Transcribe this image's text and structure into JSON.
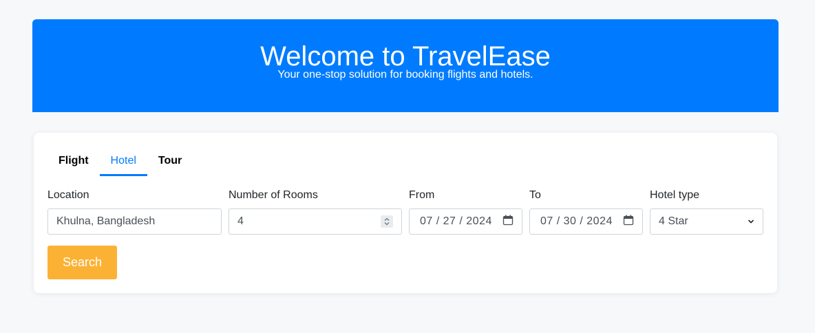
{
  "header": {
    "title": "Welcome to TravelEase",
    "subtitle": "Your one-stop solution for booking flights and hotels.",
    "bg_color": "#007bff"
  },
  "tabs": [
    {
      "label": "Flight",
      "active": false
    },
    {
      "label": "Hotel",
      "active": true
    },
    {
      "label": "Tour",
      "active": false
    }
  ],
  "form": {
    "location": {
      "label": "Location",
      "value": "Khulna, Bangladesh"
    },
    "rooms": {
      "label": "Number of Rooms",
      "value": "4"
    },
    "from": {
      "label": "From",
      "value": "07 / 27 / 2024"
    },
    "to": {
      "label": "To",
      "value": "07 / 30 / 2024"
    },
    "hotel_type": {
      "label": "Hotel type",
      "value": "4 Star"
    },
    "search_label": "Search",
    "search_color": "#fbb234"
  },
  "icons": {
    "stepper": "number-stepper-icon",
    "calendar": "calendar-icon",
    "select": "chevron-down-icon"
  }
}
